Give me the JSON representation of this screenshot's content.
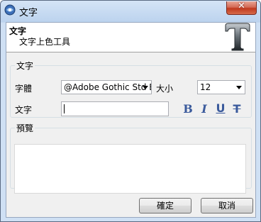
{
  "window": {
    "title": "文字",
    "close_label": "✕"
  },
  "header": {
    "title": "文字",
    "subtitle": "文字上色工具"
  },
  "text_group": {
    "legend": "文字",
    "font_label": "字體",
    "font_value": "@Adobe Gothic Std B",
    "size_label": "大小",
    "size_value": "12",
    "text_label": "文字",
    "text_value": "",
    "format_buttons": {
      "bold": "B",
      "italic": "I",
      "underline": "U",
      "strike": "T"
    }
  },
  "preview_group": {
    "legend": "預覽"
  },
  "buttons": {
    "ok": "確定",
    "cancel": "取消"
  },
  "colors": {
    "accent": "#3a5a9c",
    "close": "#c0391e"
  }
}
